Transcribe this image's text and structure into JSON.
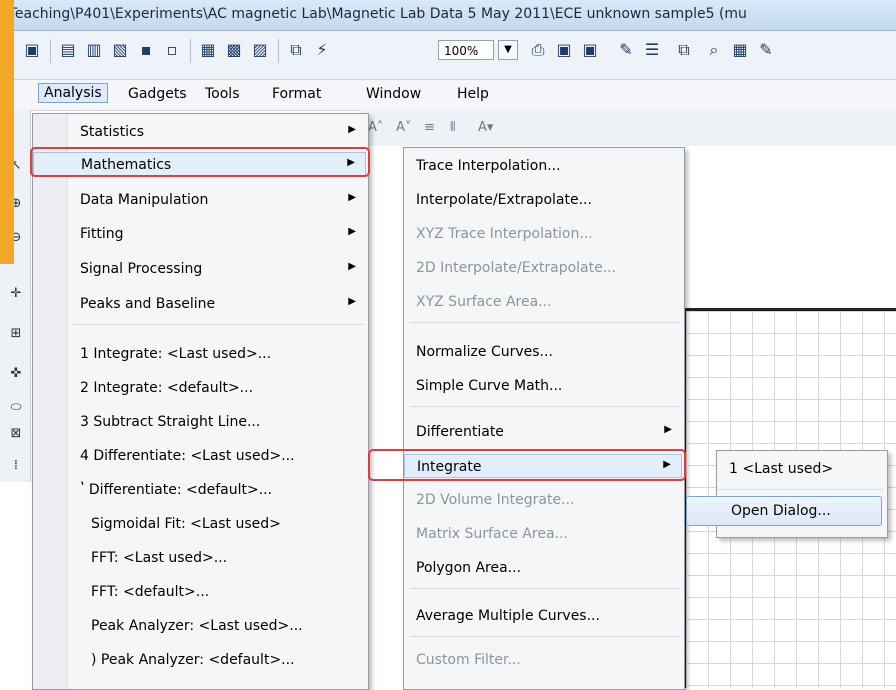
{
  "window": {
    "title": "\\Teaching\\P401\\Experiments\\AC magnetic Lab\\Magnetic Lab  Data 5 May 2011\\ECE unknown sample5 (mu"
  },
  "toolbar": {
    "zoom_value": "100%",
    "zoom_dropdown_icon": "chevron-down-icon"
  },
  "menubar": {
    "items": [
      "Analysis",
      "Gadgets",
      "Tools",
      "Format",
      "Window",
      "Help"
    ]
  },
  "analysis_menu": {
    "items": [
      "Statistics",
      "Mathematics",
      "Data Manipulation",
      "Fitting",
      "Signal Processing",
      "Peaks and Baseline",
      "1 Integrate: <Last used>...",
      "2 Integrate: <default>...",
      "3 Subtract Straight Line...",
      "4 Differentiate: <Last used>...",
      "5 Differentiate: <default>...",
      "Sigmoidal Fit: <Last used>",
      "FFT: <Last used>...",
      "FFT: <default>...",
      "Peak Analyzer: <Last used>...",
      "0 Peak Analyzer: <default>..."
    ],
    "visible_items": {
      "item10": "ʽ Differentiate: <default>...",
      "item16": ") Peak Analyzer: <default>..."
    }
  },
  "mathematics_menu": {
    "items": [
      "Trace Interpolation...",
      "Interpolate/Extrapolate...",
      "XYZ Trace Interpolation...",
      "2D Interpolate/Extrapolate...",
      "XYZ Surface Area...",
      "Normalize Curves...",
      "Simple Curve Math...",
      "Differentiate",
      "Integrate",
      "2D Volume Integrate...",
      "Matrix Surface Area...",
      "Polygon Area...",
      "Average Multiple Curves...",
      "Custom Filter..."
    ]
  },
  "integrate_menu": {
    "items": [
      "1 <Last used>",
      "Open Dialog..."
    ]
  },
  "colors": {
    "highlight_outline": "#e23b3b",
    "accent": "#f4a82a"
  }
}
